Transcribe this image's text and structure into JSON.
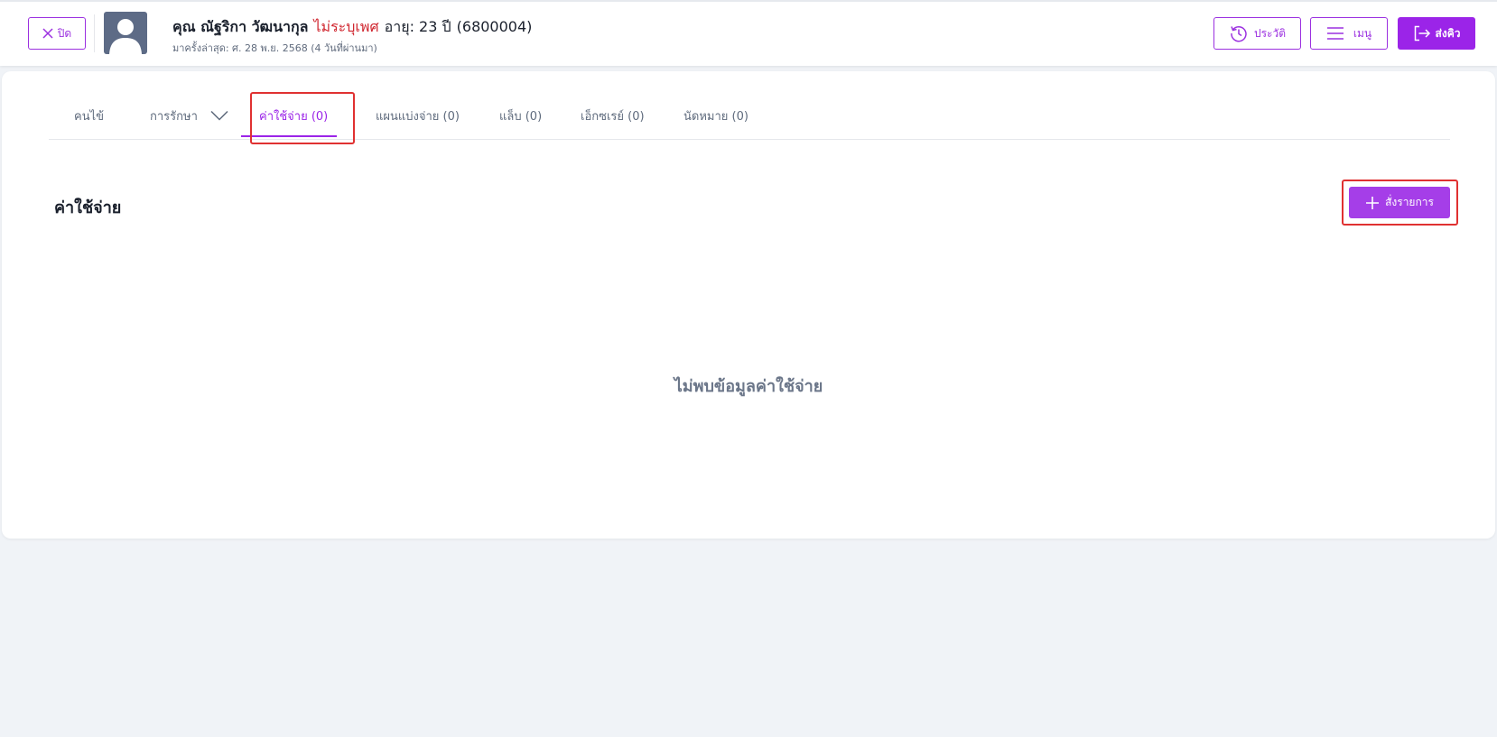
{
  "header": {
    "close_label": "ปิด",
    "patient": {
      "name": "คุณ ณัฐริกา วัฒนากุล",
      "gender": "ไม่ระบุเพศ",
      "age": "อายุ: 23 ปี",
      "hn": "(6800004)",
      "last_visit": "มาครั้งล่าสุด: ศ. 28 พ.ย. 2568 (4 วันที่ผ่านมา)"
    },
    "history_label": "ประวัติ",
    "menu_label": "เมนู",
    "queue_label": "ส่งคิว"
  },
  "tabs": [
    {
      "label": "คนไข้",
      "active": false
    },
    {
      "label": "การรักษา",
      "active": false,
      "has_dropdown": true
    },
    {
      "label": "ค่าใช้จ่าย (0)",
      "active": true
    },
    {
      "label": "แผนแบ่งจ่าย (0)",
      "active": false
    },
    {
      "label": "แล็บ (0)",
      "active": false
    },
    {
      "label": "เอ็กซเรย์ (0)",
      "active": false
    },
    {
      "label": "นัดหมาย (0)",
      "active": false
    }
  ],
  "main": {
    "section_title": "ค่าใช้จ่าย",
    "add_button_label": "สั่งรายการ",
    "empty_message": "ไม่พบข้อมูลค่าใช้จ่าย"
  },
  "colors": {
    "accent": "#9b24e8",
    "gender_text": "#d0262f",
    "highlight": "#e03131",
    "background": "#f0f3f7"
  },
  "icons": {
    "close": "close-icon",
    "history": "history-icon",
    "menu": "hamburger-icon",
    "queue": "send-queue-icon",
    "add": "plus-icon",
    "dropdown": "chevron-down-icon"
  }
}
